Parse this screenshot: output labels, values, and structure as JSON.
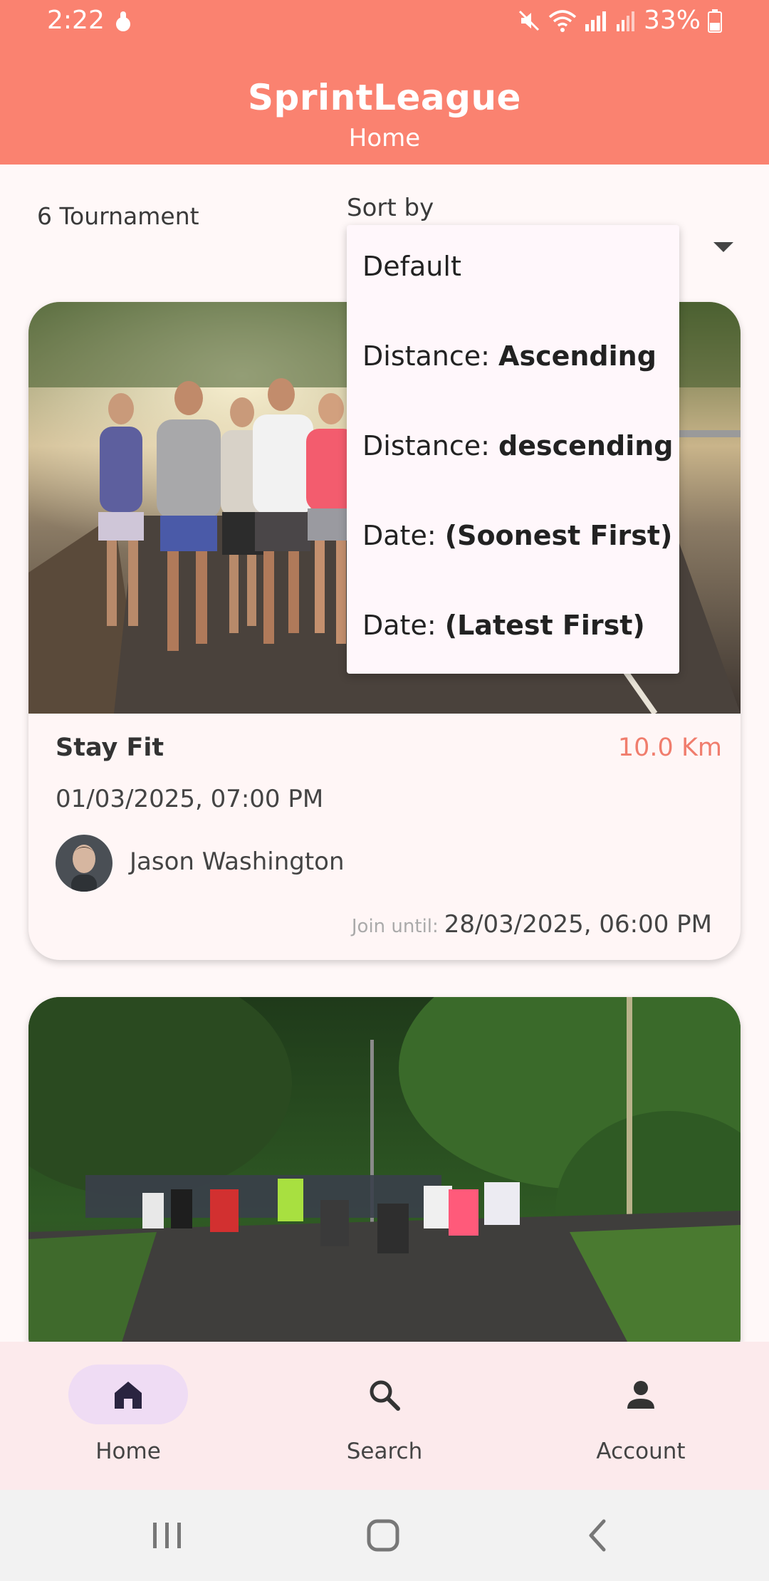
{
  "status_bar": {
    "time": "2:22",
    "battery": "33%"
  },
  "header": {
    "title": "SprintLeague",
    "subtitle": "Home"
  },
  "filter": {
    "count_label": "6 Tournament",
    "sort_label": "Sort by"
  },
  "sort_menu": {
    "items": [
      {
        "prefix": "Default",
        "value": ""
      },
      {
        "prefix": "Distance: ",
        "value": "Ascending"
      },
      {
        "prefix": "Distance: ",
        "value": "descending"
      },
      {
        "prefix": "Date: ",
        "value": "(Soonest First)"
      },
      {
        "prefix": "Date: ",
        "value": "(Latest First)"
      }
    ]
  },
  "tournaments": [
    {
      "title": "Stay Fit",
      "distance": "10.0 Km",
      "date": "01/03/2025, 07:00 PM",
      "organizer": "Jason Washington",
      "join_label": "Join until:",
      "join_date": "28/03/2025, 06:00 PM"
    }
  ],
  "bottom_nav": {
    "items": [
      {
        "label": "Home",
        "icon": "home-icon",
        "active": true
      },
      {
        "label": "Search",
        "icon": "search-icon",
        "active": false
      },
      {
        "label": "Account",
        "icon": "person-icon",
        "active": false
      }
    ]
  },
  "colors": {
    "primary": "#FA8270",
    "distance": "#F07D6D",
    "nav_bg": "#FCEAEC",
    "nav_active_pill": "#EFDCF4"
  }
}
